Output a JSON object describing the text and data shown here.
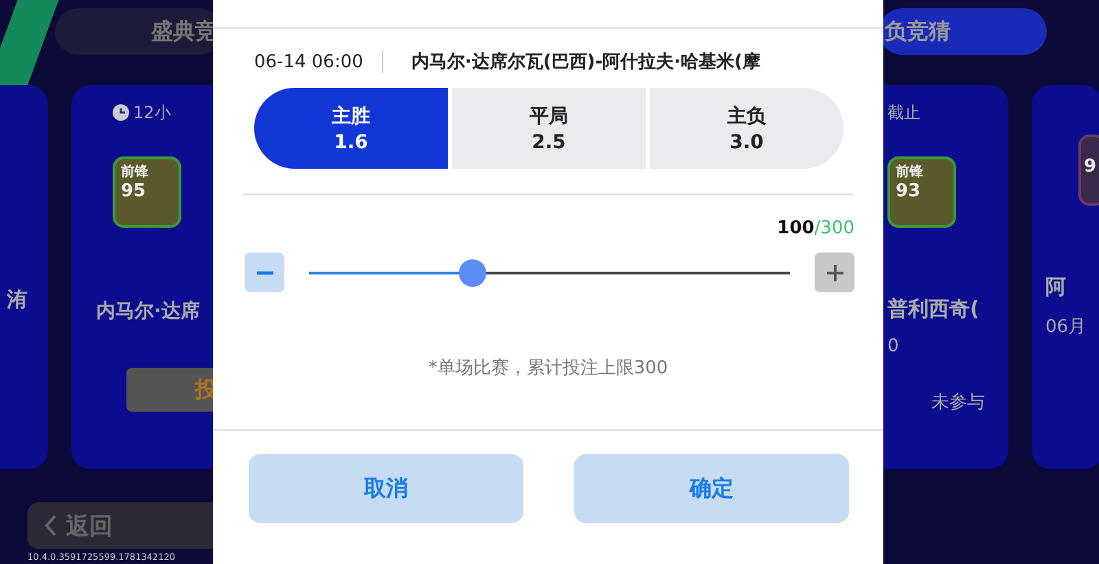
{
  "top_tabs": [
    {
      "label": "盛典竞",
      "selected": false
    },
    {
      "label": "负竞猜",
      "selected": true
    }
  ],
  "cards_left": [
    {
      "name": "洧"
    },
    {
      "timer": "12小",
      "badge": {
        "position": "前锋",
        "rating": "95"
      },
      "name": "内马尔·达席",
      "action": "投"
    }
  ],
  "cards_right": [
    {
      "deadline": "截止",
      "badge": {
        "position": "前锋",
        "rating": "93"
      },
      "name": "普利西奇(",
      "subtitle": "0",
      "status": "未参与"
    },
    {
      "badge": {
        "rating": "9"
      },
      "name": "阿",
      "subtitle": "06月"
    }
  ],
  "back_button": {
    "label": "返回"
  },
  "version": "10.4.0.3591725599.1781342120",
  "dialog": {
    "match_time": "06-14 06:00",
    "match_title": "内马尔·达席尔瓦(巴西)-阿什拉夫·哈基米(摩",
    "options": [
      {
        "label": "主胜",
        "odds": "1.6",
        "selected": true
      },
      {
        "label": "平局",
        "odds": "2.5",
        "selected": false
      },
      {
        "label": "主负",
        "odds": "3.0",
        "selected": false
      }
    ],
    "amount": "100",
    "limit": "/300",
    "stake_slider": {
      "level": 0.34
    },
    "note": "*单场比赛，累计投注上限300",
    "buttons": [
      "取消",
      "确定"
    ]
  }
}
